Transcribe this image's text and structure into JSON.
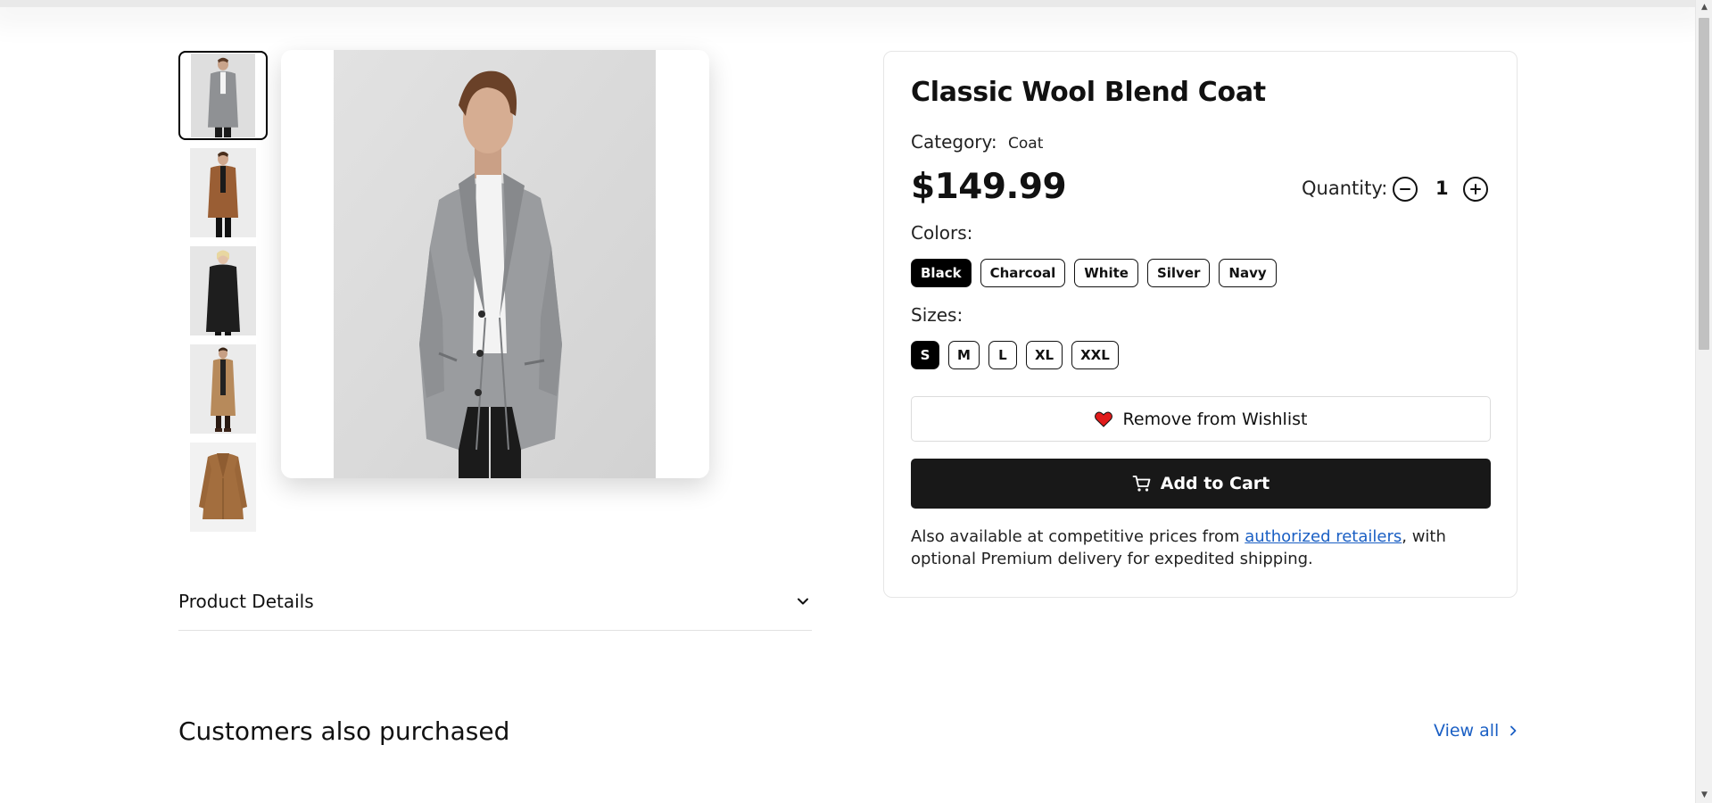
{
  "product": {
    "title": "Classic Wool Blend Coat",
    "category_label": "Category:",
    "category_value": "Coat",
    "price": "$149.99",
    "quantity_label": "Quantity:",
    "quantity_value": "1",
    "colors_label": "Colors:",
    "colors": [
      {
        "label": "Black",
        "selected": true
      },
      {
        "label": "Charcoal",
        "selected": false
      },
      {
        "label": "White",
        "selected": false
      },
      {
        "label": "Silver",
        "selected": false
      },
      {
        "label": "Navy",
        "selected": false
      }
    ],
    "sizes_label": "Sizes:",
    "sizes": [
      {
        "label": "S",
        "selected": true
      },
      {
        "label": "M",
        "selected": false
      },
      {
        "label": "L",
        "selected": false
      },
      {
        "label": "XL",
        "selected": false
      },
      {
        "label": "XXL",
        "selected": false
      }
    ],
    "wishlist_label": "Remove from Wishlist",
    "cart_label": "Add to Cart",
    "note_prefix": "Also available at competitive prices from ",
    "note_link": "authorized retailers",
    "note_suffix": ", with optional Premium delivery for expedited shipping."
  },
  "gallery": {
    "thumbnails": [
      {
        "name": "grey-coat-thumb",
        "coat_color": "#8f9194",
        "active": true
      },
      {
        "name": "camel-coat-thumb",
        "coat_color": "#9a5e34",
        "active": false
      },
      {
        "name": "black-coat-thumb",
        "coat_color": "#1e1e1e",
        "active": false
      },
      {
        "name": "tan-long-coat-thumb",
        "coat_color": "#b78a5b",
        "active": false
      },
      {
        "name": "tan-flat-coat-thumb",
        "coat_color": "#a36e3e",
        "active": false
      }
    ]
  },
  "details": {
    "accordion_title": "Product Details"
  },
  "related": {
    "title": "Customers also purchased",
    "view_all": "View all"
  },
  "colors": {
    "accent_link": "#1a5fc4",
    "button_dark": "#181818",
    "heart": "#e01b1b"
  },
  "icons": [
    "chevron-down-icon",
    "minus-icon",
    "plus-icon",
    "heart-icon",
    "cart-icon",
    "chevron-right-icon"
  ]
}
